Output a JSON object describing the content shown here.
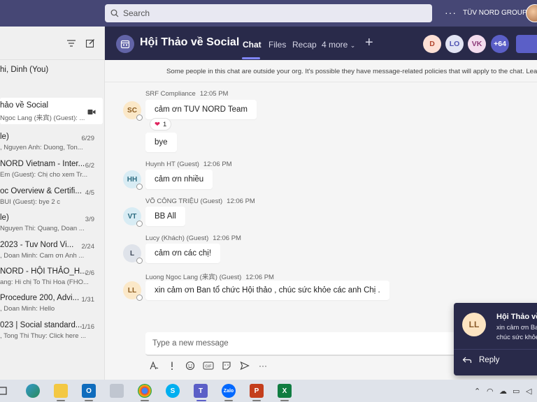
{
  "topbar": {
    "search_placeholder": "Search",
    "more": "···",
    "org": "TÜV NORD GROUP"
  },
  "sidebar": {
    "chats": [
      {
        "title": "hi, Dinh (You)",
        "subtitle": "",
        "date": ""
      },
      {
        "title": "hảo về Social",
        "subtitle": "Ngoc Lang (来宾) (Guest): ...",
        "date": ""
      },
      {
        "title": "le)",
        "subtitle": ", Nguyen Anh: Duong, Ton...",
        "date": "6/29"
      },
      {
        "title": "NORD Vietnam - Inter...",
        "subtitle": "Em (Guest): Chị cho xem Tr...",
        "date": "6/2"
      },
      {
        "title": "oc Overview & Certifi...",
        "subtitle": "BUI (Guest): bye 2 c",
        "date": "4/5"
      },
      {
        "title": "le)",
        "subtitle": "Nguyen Thi: Quang, Doan ...",
        "date": "3/9"
      },
      {
        "title": "2023 - Tuv Nord Vi...",
        "subtitle": ", Doan Minh: Cam ơn Anh ...",
        "date": "2/24"
      },
      {
        "title": "NORD - HỘI THẢO_H...",
        "subtitle": "ang: Hi chị To Thi Hoa (FHO...",
        "date": "2/6"
      },
      {
        "title": "Procedure 200, Advi...",
        "subtitle": ", Doan Minh: Hello",
        "date": "1/31"
      },
      {
        "title": "023 | Social standard...",
        "subtitle": ", Tong Thi Thuy: Click here ...",
        "date": "1/16"
      }
    ]
  },
  "header": {
    "title": "Hội Thảo về Social",
    "tabs": [
      "Chat",
      "Files",
      "Recap",
      "4 more"
    ],
    "participants": [
      {
        "initials": "D",
        "bg": "#fde0d5",
        "fg": "#b2462e"
      },
      {
        "initials": "LO",
        "bg": "#e2e4f4",
        "fg": "#4f52b2"
      },
      {
        "initials": "VK",
        "bg": "#f3dcee",
        "fg": "#8e3b7a"
      }
    ],
    "more_count": "+64"
  },
  "notice": "Some people in this chat are outside your org. It's possible they have message-related policies that will apply to the chat. Lear",
  "messages": [
    {
      "initials": "SC",
      "author": "SRF Compliance",
      "time": "12:05 PM",
      "texts": [
        "cảm ơn TUV NORD Team",
        "bye"
      ],
      "reaction": "1",
      "av_bg": "#fbe8c8",
      "av_fg": "#8a5a1e"
    },
    {
      "initials": "HH",
      "author": "Huynh HT (Guest)",
      "time": "12:06 PM",
      "texts": [
        "cảm ơn nhiều"
      ],
      "av_bg": "#d8ecf4",
      "av_fg": "#2c6b80"
    },
    {
      "initials": "VT",
      "author": "VÕ CÔNG TRIỆU (Guest)",
      "time": "12:06 PM",
      "texts": [
        "BB All"
      ],
      "av_bg": "#d8ecf4",
      "av_fg": "#2c6b80"
    },
    {
      "initials": "L",
      "author": "Lucy (Khách) (Guest)",
      "time": "12:06 PM",
      "texts": [
        "cảm ơn các chị!"
      ],
      "av_bg": "#dfe3ea",
      "av_fg": "#3b4556"
    },
    {
      "initials": "LL",
      "author": "Luong Ngoc Lang (来宾) (Guest)",
      "time": "12:06 PM",
      "texts": [
        "xin cảm ơn Ban tổ chức Hội thảo , chúc sức khỏe các anh Chị ."
      ],
      "av_bg": "#fbe8c8",
      "av_fg": "#8a5a1e"
    }
  ],
  "compose": {
    "placeholder": "Type a new message"
  },
  "toast": {
    "initials": "LL",
    "title": "Hội Thảo về",
    "body_line1": "xin cảm ơn Ba",
    "body_line2": "chúc sức khỏe",
    "reply": "Reply"
  },
  "colors": {
    "accent": "#5b5fc7",
    "topbar": "#464775",
    "header": "#292a4a"
  }
}
